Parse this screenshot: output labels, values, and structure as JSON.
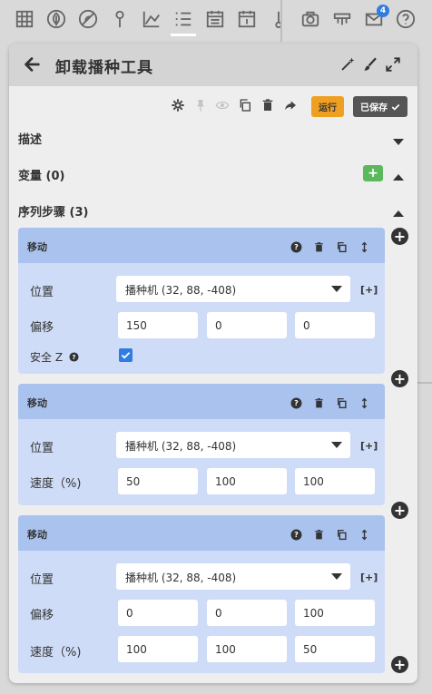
{
  "nav": {
    "items": [
      {
        "name": "grid",
        "active": false
      },
      {
        "name": "leaf",
        "active": false
      },
      {
        "name": "no-weeds",
        "active": false
      },
      {
        "name": "map-pin",
        "active": false
      },
      {
        "name": "chart",
        "active": false
      },
      {
        "name": "sequence",
        "active": true
      },
      {
        "name": "calendar",
        "active": false
      },
      {
        "name": "calendar-day",
        "active": false
      },
      {
        "name": "thermometer",
        "active": false
      },
      {
        "name": "camera",
        "active": false
      },
      {
        "name": "farmbot",
        "active": false
      },
      {
        "name": "mail",
        "active": false,
        "badge": "4"
      },
      {
        "name": "help",
        "active": false
      }
    ]
  },
  "header": {
    "title": "卸载播种工具"
  },
  "toolbar": {
    "run_label": "运行",
    "saved_label": "已保存"
  },
  "sections": {
    "description": "描述",
    "variables": "变量 (0)",
    "steps": "序列步骤 (3)"
  },
  "steps": [
    {
      "title": "移动",
      "location_label": "位置",
      "location_value": "播种机 (32, 88, -408)",
      "bracket_plus": "[+]",
      "offset_label": "偏移",
      "offset": [
        "150",
        "0",
        "0"
      ],
      "safe_z_label": "安全 Z",
      "safe_z_checked": true
    },
    {
      "title": "移动",
      "location_label": "位置",
      "location_value": "播种机 (32, 88, -408)",
      "bracket_plus": "[+]",
      "speed_label": "速度（%)",
      "speed": [
        "50",
        "100",
        "100"
      ]
    },
    {
      "title": "移动",
      "location_label": "位置",
      "location_value": "播种机 (32, 88, -408)",
      "bracket_plus": "[+]",
      "offset_label": "偏移",
      "offset": [
        "0",
        "0",
        "100"
      ],
      "speed_label": "速度（%)",
      "speed": [
        "100",
        "100",
        "50"
      ]
    }
  ],
  "colors": {
    "step_header": "#a9c2ee",
    "step_body": "#cfdcf7",
    "run": "#f0a020",
    "saved": "#555555",
    "add_variable": "#5cb85c",
    "badge": "#2f7de1"
  }
}
